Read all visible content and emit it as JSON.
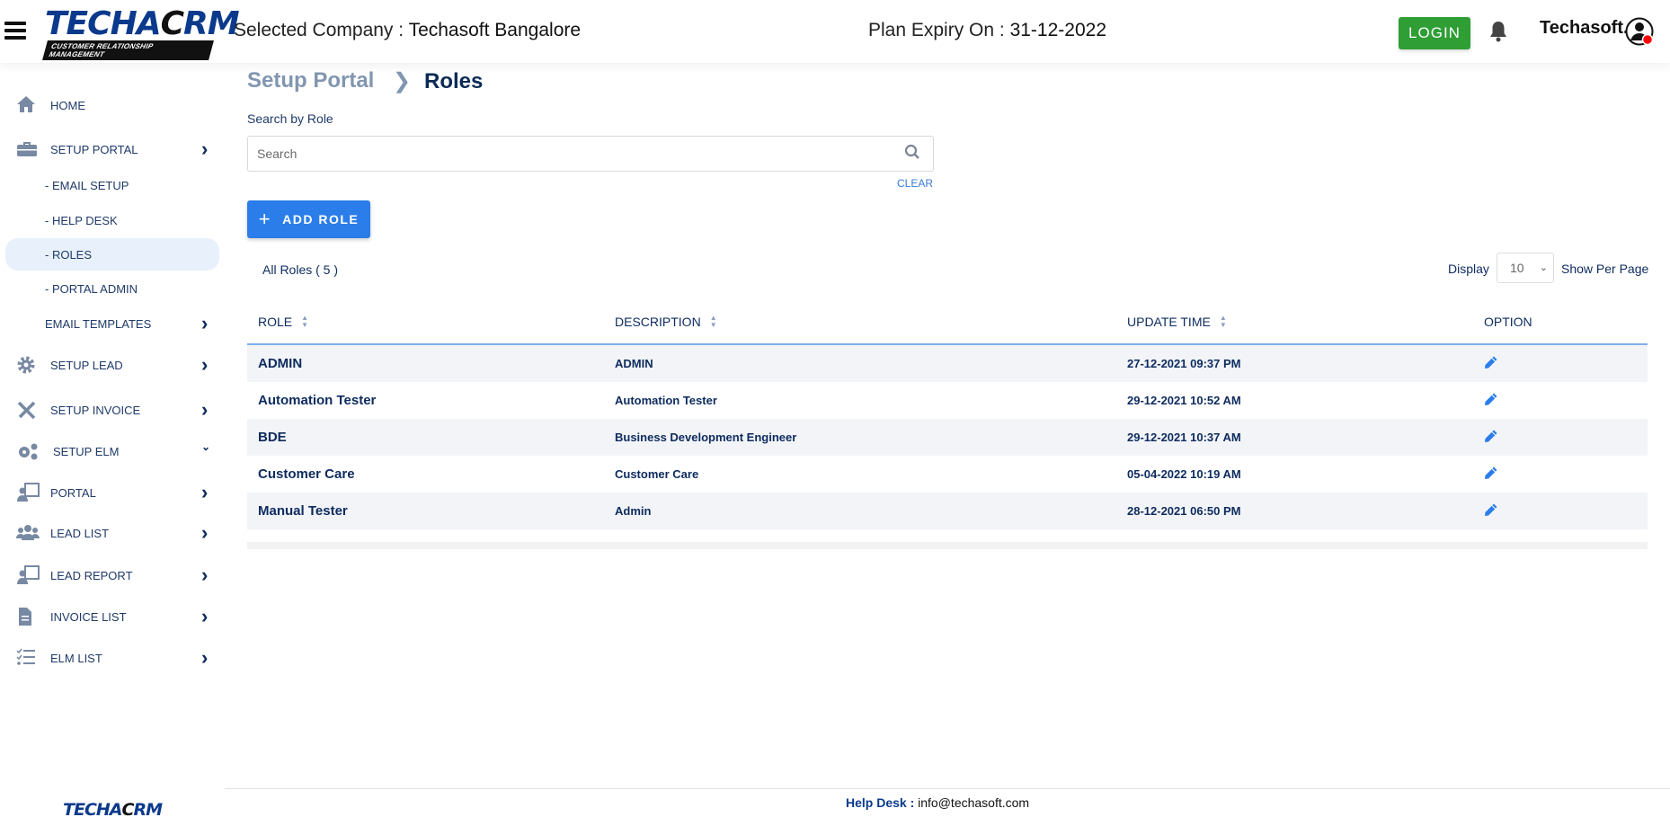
{
  "header": {
    "logo_text": "TECHACRM",
    "logo_tagline": "CUSTOMER RELATIONSHIP MANAGEMENT",
    "selected_company_label": "Selected Company :",
    "selected_company": "Techasoft Bangalore",
    "plan_expiry_label": "Plan Expiry On :",
    "plan_expiry": "31-12-2022",
    "login_label": "LOGIN",
    "user_name": "Techasoft.",
    "login_color": "#2f9e35"
  },
  "sidebar": {
    "items": [
      {
        "label": "HOME",
        "icon": "home-icon"
      },
      {
        "label": "SETUP PORTAL",
        "icon": "toolbox-icon"
      },
      {
        "label": "- EMAIL SETUP"
      },
      {
        "label": "- HELP DESK"
      },
      {
        "label": "- ROLES",
        "active": true
      },
      {
        "label": "- PORTAL ADMIN"
      },
      {
        "label": "EMAIL TEMPLATES"
      },
      {
        "label": "SETUP LEAD",
        "icon": "gear-icon"
      },
      {
        "label": "SETUP INVOICE",
        "icon": "tools-icon"
      },
      {
        "label": "SETUP ELM",
        "icon": "gears-icon"
      },
      {
        "label": "PORTAL",
        "icon": "presentation-icon"
      },
      {
        "label": "LEAD LIST",
        "icon": "users-icon"
      },
      {
        "label": "LEAD REPORT",
        "icon": "presentation-icon"
      },
      {
        "label": "INVOICE LIST",
        "icon": "document-icon"
      },
      {
        "label": "ELM LIST",
        "icon": "checklist-icon"
      }
    ],
    "footer_logo": "TECHACRM"
  },
  "main": {
    "breadcrumb": {
      "parent": "Setup Portal",
      "separator": ">",
      "current": "Roles"
    },
    "search_label": "Search by Role",
    "search_placeholder": "Search",
    "search_value": "",
    "clear_label": "CLEAR",
    "add_role_label": "ADD ROLE",
    "all_roles_label": "All Roles ( 5 )",
    "display_label": "Display",
    "per_page_value": "10",
    "show_per_page_label": "Show Per Page",
    "columns": [
      "ROLE",
      "DESCRIPTION",
      "UPDATE TIME",
      "OPTION"
    ],
    "rows": [
      {
        "role": "ADMIN",
        "description": "ADMIN",
        "update_time": "27-12-2021 09:37 PM"
      },
      {
        "role": "Automation Tester",
        "description": "Automation Tester",
        "update_time": "29-12-2021 10:52 AM"
      },
      {
        "role": "BDE",
        "description": "Business Development Engineer",
        "update_time": "29-12-2021 10:37 AM"
      },
      {
        "role": "Customer Care",
        "description": "Customer Care",
        "update_time": "05-04-2022 10:19 AM"
      },
      {
        "role": "Manual Tester",
        "description": "Admin",
        "update_time": "28-12-2021 06:50 PM"
      }
    ],
    "accent_color": "#2b7de9"
  },
  "footer": {
    "help_desk_label": "Help Desk :",
    "help_desk_email": "info@techasoft.com"
  }
}
